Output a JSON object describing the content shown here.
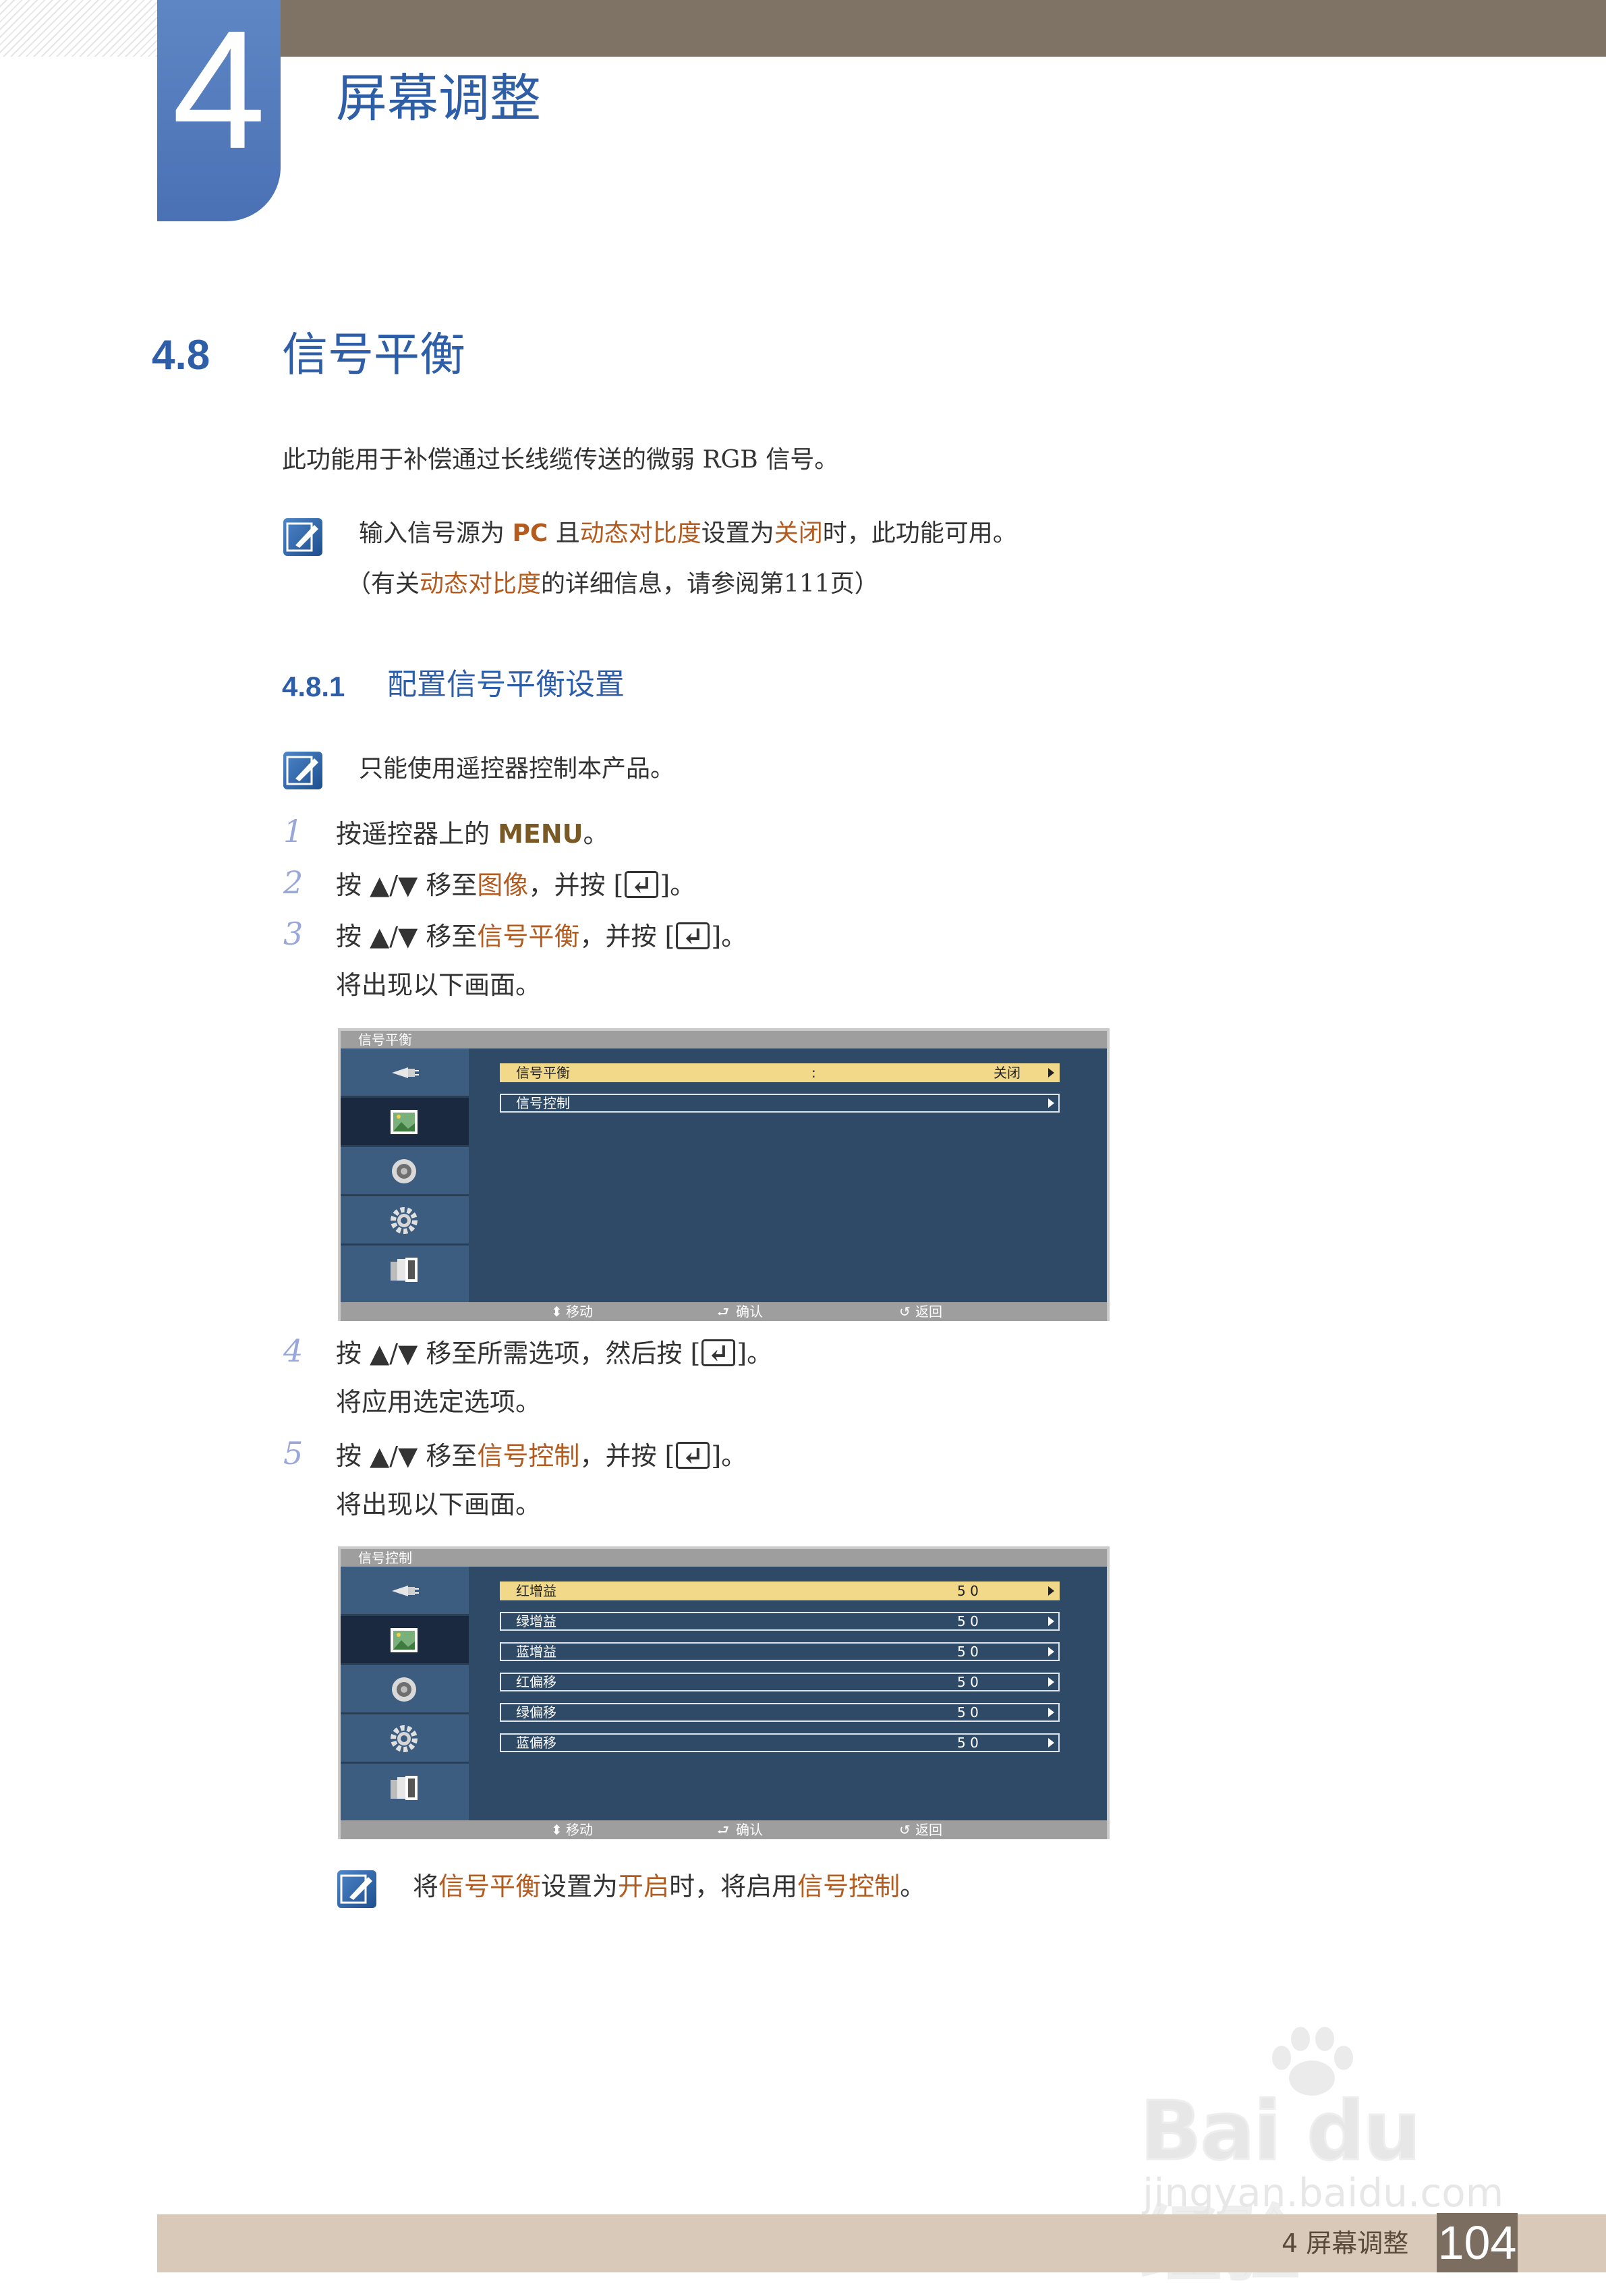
{
  "header": {
    "chapter_number": "4",
    "chapter_title": "屏幕调整"
  },
  "section": {
    "number": "4.8",
    "title": "信号平衡"
  },
  "intro": "此功能用于补偿通过长线缆传送的微弱 RGB 信号。",
  "note1": {
    "l1_a": "输入信号源为 ",
    "l1_b": "PC",
    "l1_c": " 且",
    "l1_d": "动态对比度",
    "l1_e": "设置为",
    "l1_f": "关闭",
    "l1_g": "时，此功能可用。",
    "l2_a": "（有关",
    "l2_b": "动态对比度",
    "l2_c": "的详细信息，请参阅第111页）"
  },
  "subsection": {
    "number": "4.8.1",
    "title": "配置信号平衡设置"
  },
  "note2": "只能使用遥控器控制本产品。",
  "steps": [
    {
      "num": "1",
      "a": "按遥控器上的 ",
      "b": "MENU",
      "c": "。"
    },
    {
      "num": "2",
      "a": "按 ▲/▼ 移至",
      "b": "图像",
      "c": "，并按 [",
      "d": "]。"
    },
    {
      "num": "3",
      "a": "按 ▲/▼ 移至",
      "b": "信号平衡",
      "c": "，并按 [",
      "d": "]。",
      "sub": "将出现以下画面。"
    },
    {
      "num": "4",
      "a": "按 ▲/▼ 移至所需选项，然后按 [",
      "d": "]。",
      "sub": "将应用选定选项。"
    },
    {
      "num": "5",
      "a": "按 ▲/▼ 移至",
      "b": "信号控制",
      "c": "，并按 [",
      "d": "]。",
      "sub": "将出现以下画面。"
    }
  ],
  "osd1": {
    "title": "信号平衡",
    "rows": [
      {
        "label": "信号平衡",
        "colon": ":",
        "value": "关闭"
      },
      {
        "label": "信号控制",
        "value": ""
      }
    ],
    "footer": {
      "move": "移动",
      "enter": "确认",
      "return": "返回"
    }
  },
  "osd2": {
    "title": "信号控制",
    "rows": [
      {
        "label": "红增益",
        "value": "5 0"
      },
      {
        "label": "绿增益",
        "value": "5 0"
      },
      {
        "label": "蓝增益",
        "value": "5 0"
      },
      {
        "label": "红偏移",
        "value": "5 0"
      },
      {
        "label": "绿偏移",
        "value": "5 0"
      },
      {
        "label": "蓝偏移",
        "value": "5 0"
      }
    ],
    "footer": {
      "move": "移动",
      "enter": "确认",
      "return": "返回"
    }
  },
  "note3": {
    "a": "将",
    "b": "信号平衡",
    "c": "设置为",
    "d": "开启",
    "e": "时，将启用",
    "f": "信号控制",
    "g": "。"
  },
  "footer": {
    "chapter_label": "4 屏幕调整",
    "page_number": "104"
  },
  "watermark": {
    "brand": "Bai du 经验",
    "url": "jingyan.baidu.com"
  },
  "colors": {
    "heading_blue": "#2f5ea8",
    "highlight": "#b45b1f",
    "header_brown": "#7f7365",
    "footer_tan": "#d9c9b8"
  }
}
